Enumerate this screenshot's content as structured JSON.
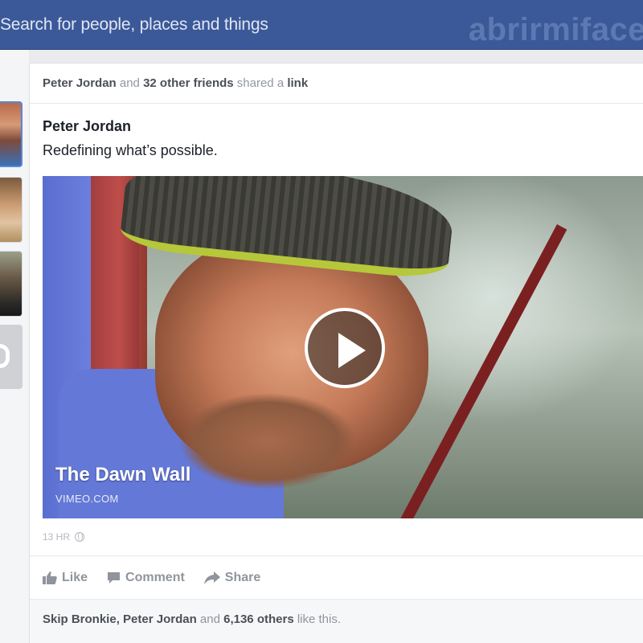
{
  "topbar": {
    "search_placeholder": "Search for people, places and things",
    "watermark": "abrirmiface"
  },
  "story": {
    "header": {
      "actor": "Peter Jordan",
      "connector": "and",
      "others": "32 other friends",
      "verb": "shared a",
      "object": "link"
    },
    "author": "Peter Jordan",
    "message": "Redefining what’s possible.",
    "video": {
      "title": "The Dawn Wall",
      "source": "VIMEO.COM"
    },
    "timestamp": "13 HR",
    "actions": {
      "like": "Like",
      "comment": "Comment",
      "share": "Share"
    },
    "likes": {
      "name1": "Skip Bronkie,",
      "name2": "Peter Jordan",
      "connector": "and",
      "others": "6,136 others",
      "suffix": "like this."
    }
  },
  "colors": {
    "brand": "#3b5998",
    "link_gray": "#90949c"
  }
}
